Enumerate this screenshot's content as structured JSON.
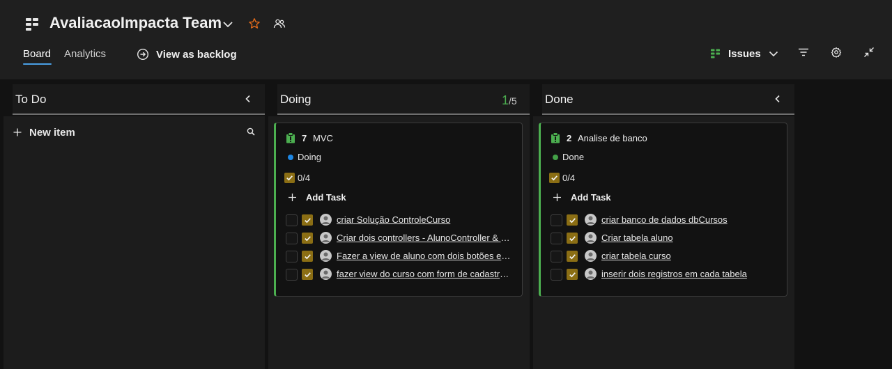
{
  "header": {
    "team_name": "AvaliacaoImpacta Team",
    "tabs": [
      {
        "label": "Board",
        "active": true
      },
      {
        "label": "Analytics",
        "active": false
      }
    ],
    "view_as_backlog": "View as backlog",
    "backlog_level": "Issues",
    "icons": [
      "boards-icon",
      "chevron-down-icon",
      "star-icon",
      "team-members-icon",
      "arrow-circle-right-icon",
      "filter-icon",
      "gear-icon",
      "collapse-icon"
    ]
  },
  "colors": {
    "accent": "#4aa0e6",
    "card_border": "#4caf50",
    "doing_dot": "#1e88e5",
    "done_dot": "#43a047",
    "task_check": "#8b6e14",
    "star": "#e06a1b"
  },
  "columns": {
    "todo": {
      "title": "To Do",
      "new_item": "New item"
    },
    "doing": {
      "title": "Doing",
      "wip_current": "1",
      "wip_max": "/5"
    },
    "done": {
      "title": "Done"
    }
  },
  "cards": {
    "mvc": {
      "id": "7",
      "title": "MVC",
      "state": "Doing",
      "progress": "0/4",
      "add_task": "Add Task",
      "tasks": [
        "criar Solução ControleCurso",
        "Criar dois controllers - AlunoController & CursoController",
        "Fazer a view de aluno com dois botões e seus respectivos campos",
        "fazer view do curso com form de cadastro e listagem"
      ]
    },
    "analise": {
      "id": "2",
      "title": "Analise de banco",
      "state": "Done",
      "progress": "0/4",
      "add_task": "Add Task",
      "tasks": [
        "criar banco de dados dbCursos",
        "Criar tabela aluno",
        "criar tabela curso",
        "inserir dois registros em cada tabela"
      ]
    }
  }
}
